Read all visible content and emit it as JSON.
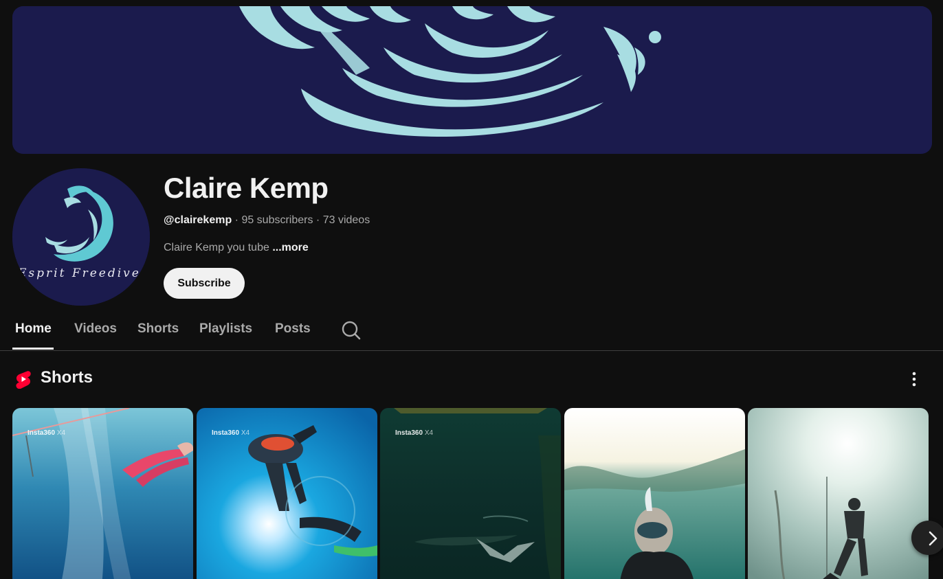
{
  "channel": {
    "name": "Claire Kemp",
    "handle": "@clairekemp",
    "separator": " · ",
    "subscribers": "95 subscribers",
    "videos": "73 videos",
    "description": "Claire Kemp you tube ",
    "more_label": "...more",
    "avatar_text": "Esprit Freediver",
    "subscribe_label": "Subscribe"
  },
  "tabs": [
    {
      "label": "Home",
      "active": true
    },
    {
      "label": "Videos",
      "active": false
    },
    {
      "label": "Shorts",
      "active": false
    },
    {
      "label": "Playlists",
      "active": false
    },
    {
      "label": "Posts",
      "active": false
    }
  ],
  "shorts_section": {
    "title": "Shorts",
    "cards": [
      {
        "watermark": "Insta360",
        "watermark_model": "X4"
      },
      {
        "watermark": "Insta360",
        "watermark_model": "X4"
      },
      {
        "watermark": "Insta360",
        "watermark_model": "X4"
      },
      {
        "watermark": "",
        "watermark_model": ""
      },
      {
        "watermark": "",
        "watermark_model": ""
      }
    ]
  },
  "icons": {
    "search": "search-icon",
    "shorts_logo": "youtube-shorts-icon",
    "more": "more-vertical-icon",
    "next": "chevron-right-icon"
  },
  "colors": {
    "background": "#0f0f0f",
    "banner_navy": "#1b1b4d",
    "wave_teal": "#a8dde2",
    "shorts_red": "#ff0033"
  }
}
